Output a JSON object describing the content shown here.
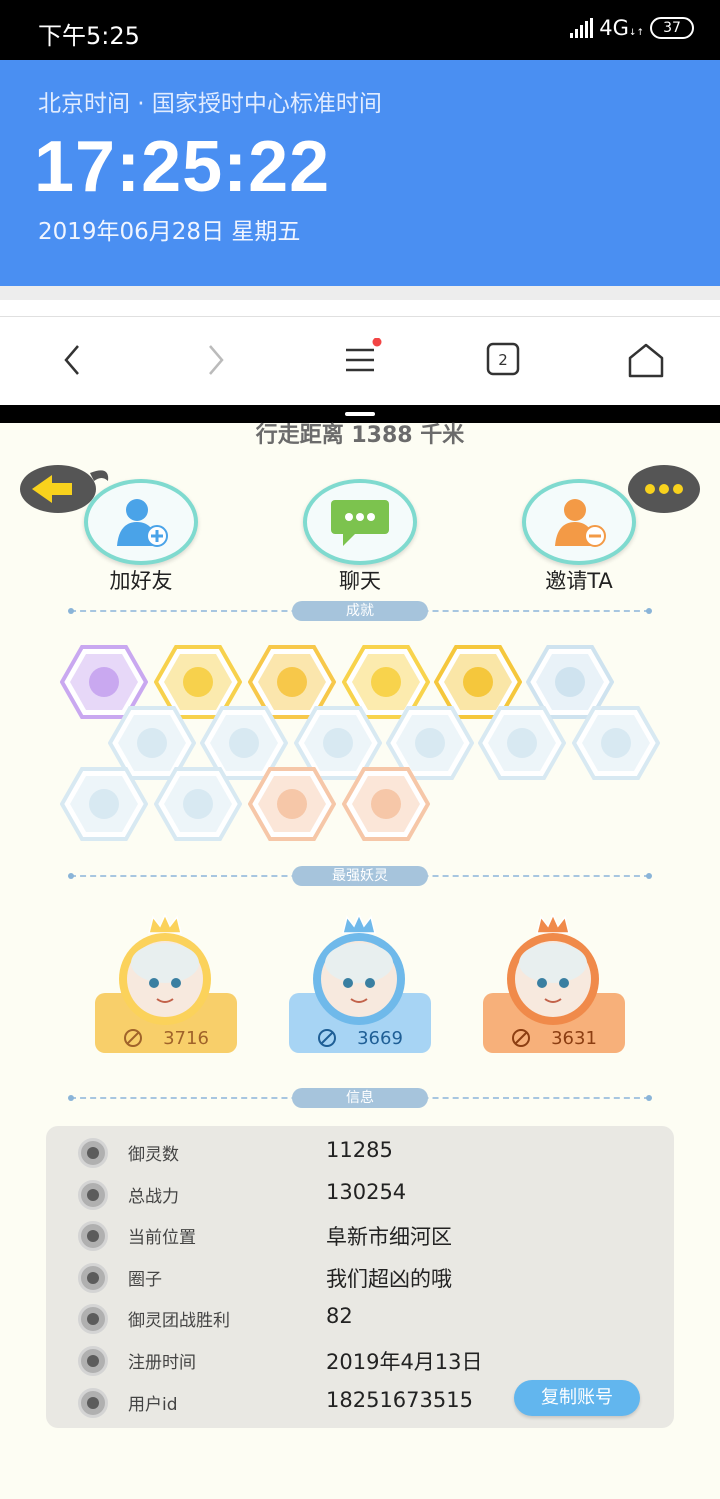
{
  "status_bar": {
    "time": "下午5:25",
    "network": "4G",
    "battery": "37"
  },
  "clock": {
    "source": "北京时间 · 国家授时中心标准时间",
    "time": "17:25:22",
    "date": "2019年06月28日  星期五"
  },
  "browser_nav": {
    "tab_count": "2",
    "icons": [
      "back-icon",
      "forward-icon",
      "menu-icon",
      "tabs-icon",
      "home-icon"
    ]
  },
  "game": {
    "distance": "行走距离 1388 千米",
    "actions": [
      {
        "label": "加好友",
        "icon": "add-friend-icon",
        "color": "#4aa3e8"
      },
      {
        "label": "聊天",
        "icon": "chat-icon",
        "color": "#7cc34e"
      },
      {
        "label": "邀请TA",
        "icon": "invite-icon",
        "color": "#f39a46"
      }
    ],
    "sections": {
      "achievements": "成就",
      "strongest": "最强妖灵",
      "info": "信息"
    },
    "achievements": [
      {
        "color": "#c9a8f0",
        "icon": "cat-badge-icon"
      },
      {
        "color": "#f7d14c",
        "icon": "shoe-badge-icon"
      },
      {
        "color": "#f7c84a",
        "icon": "mask-badge-icon"
      },
      {
        "color": "#f8d34c",
        "icon": "helmet-badge-icon"
      },
      {
        "color": "#f5c73c",
        "icon": "taiji-badge-icon"
      },
      {
        "color": "#cfe3ef",
        "icon": "orb-badge-icon"
      },
      {
        "color": "#d8e9f2",
        "icon": "moon-badge-icon"
      },
      {
        "color": "#d8e9f2",
        "icon": "crystal-badge-icon"
      },
      {
        "color": "#d8e9f2",
        "icon": "wave-badge-icon"
      },
      {
        "color": "#d8e9f2",
        "icon": "spirit-badge-icon"
      },
      {
        "color": "#d8e9f2",
        "icon": "fish-badge-icon"
      },
      {
        "color": "#d8e9f2",
        "icon": "scroll-badge-icon"
      },
      {
        "color": "#d8e9f2",
        "icon": "cat2-badge-icon"
      },
      {
        "color": "#d8e9f2",
        "icon": "book-badge-icon"
      },
      {
        "color": "#f6c7a8",
        "icon": "cart-badge-icon"
      },
      {
        "color": "#f6c7a8",
        "icon": "stool-badge-icon"
      }
    ],
    "spirits": [
      {
        "score": "3716",
        "card_color": "#f8cf6a",
        "score_color": "#a0632a",
        "ring": "#fbd25b"
      },
      {
        "score": "3669",
        "card_color": "#a7d4f4",
        "score_color": "#1f5f96",
        "ring": "#6fb9ea"
      },
      {
        "score": "3631",
        "card_color": "#f7b07a",
        "score_color": "#8c3e12",
        "ring": "#f08a4a"
      }
    ],
    "info": [
      {
        "key": "御灵数",
        "value": "11285",
        "icon": "spirit-count-icon"
      },
      {
        "key": "总战力",
        "value": "130254",
        "icon": "power-icon"
      },
      {
        "key": "当前位置",
        "value": "阜新市细河区",
        "icon": "location-icon"
      },
      {
        "key": "圈子",
        "value": "我们超凶的哦",
        "icon": "circle-icon"
      },
      {
        "key": "御灵团战胜利",
        "value": "82",
        "icon": "team-win-icon"
      },
      {
        "key": "注册时间",
        "value": "2019年4月13日",
        "icon": "clock-icon"
      },
      {
        "key": "用户id",
        "value": "18251673515",
        "icon": "id-icon"
      }
    ],
    "copy_button": "复制账号"
  }
}
